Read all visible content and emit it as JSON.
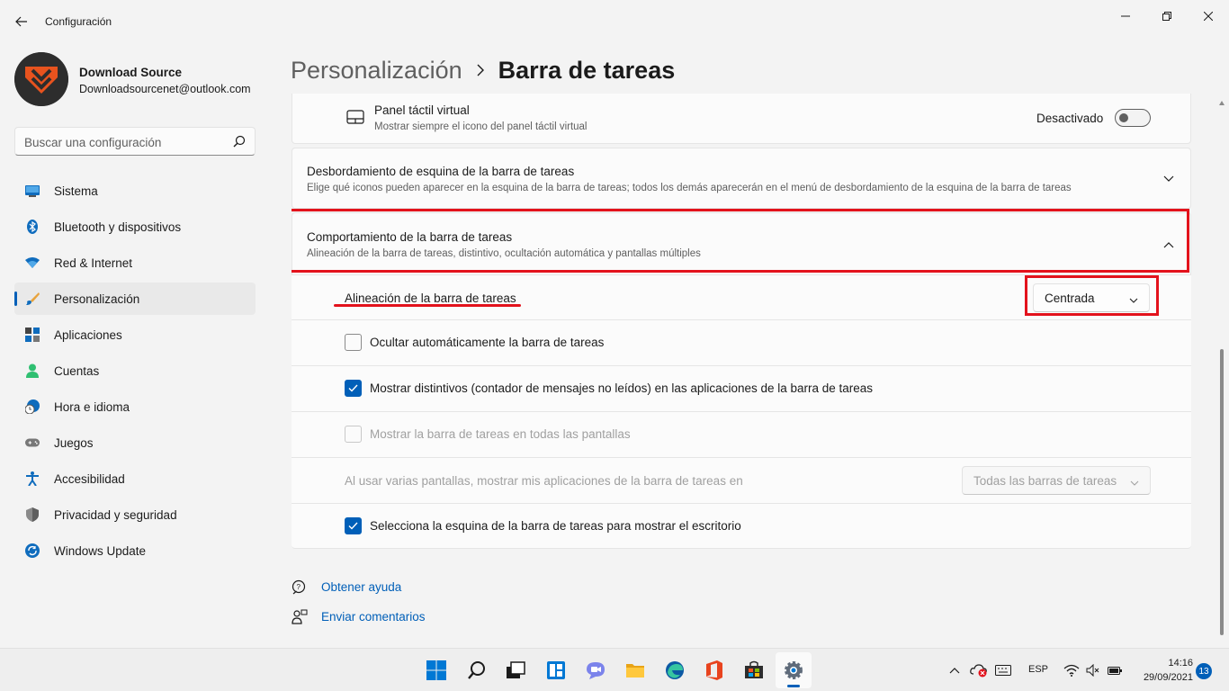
{
  "window": {
    "title": "Configuración"
  },
  "profile": {
    "name": "Download Source",
    "email": "Downloadsourcenet@outlook.com"
  },
  "search": {
    "placeholder": "Buscar una configuración"
  },
  "sidebar": {
    "items": [
      {
        "label": "Sistema",
        "icon": "system-icon"
      },
      {
        "label": "Bluetooth y dispositivos",
        "icon": "bluetooth-icon"
      },
      {
        "label": "Red & Internet",
        "icon": "wifi-icon"
      },
      {
        "label": "Personalización",
        "icon": "brush-icon",
        "active": true
      },
      {
        "label": "Aplicaciones",
        "icon": "apps-icon"
      },
      {
        "label": "Cuentas",
        "icon": "account-icon"
      },
      {
        "label": "Hora e idioma",
        "icon": "time-language-icon"
      },
      {
        "label": "Juegos",
        "icon": "gamepad-icon"
      },
      {
        "label": "Accesibilidad",
        "icon": "accessibility-icon"
      },
      {
        "label": "Privacidad y seguridad",
        "icon": "shield-icon"
      },
      {
        "label": "Windows Update",
        "icon": "update-icon"
      }
    ]
  },
  "header": {
    "parent": "Personalización",
    "current": "Barra de tareas"
  },
  "settings": {
    "touchpad": {
      "title": "Panel táctil virtual",
      "subtitle": "Mostrar siempre el icono del panel táctil virtual",
      "state_label": "Desactivado"
    },
    "overflow": {
      "title": "Desbordamiento de esquina de la barra de tareas",
      "subtitle": "Elige qué iconos pueden aparecer en la esquina de la barra de tareas; todos los demás aparecerán en el menú de desbordamiento de la esquina de la barra de tareas"
    },
    "behavior": {
      "title": "Comportamiento de la barra de tareas",
      "subtitle": "Alineación de la barra de tareas, distintivo, ocultación automática y pantallas múltiples",
      "alignment_label": "Alineación de la barra de tareas",
      "alignment_value": "Centrada",
      "autohide_label": "Ocultar automáticamente la barra de tareas",
      "badges_label": "Mostrar distintivos (contador de mensajes no leídos) en las aplicaciones de la barra de tareas",
      "all_displays_label": "Mostrar la barra de tareas en todas las pantallas",
      "multi_display_label": "Al usar varias pantallas, mostrar mis aplicaciones de la barra de tareas en",
      "multi_display_value": "Todas las barras de tareas",
      "corner_desktop_label": "Selecciona la esquina de la barra de tareas para mostrar el escritorio"
    }
  },
  "help": {
    "get_help": "Obtener ayuda",
    "feedback": "Enviar comentarios"
  },
  "taskbar": {
    "language": "ESP",
    "time": "14:16",
    "date": "29/09/2021",
    "notifications": "13"
  },
  "colors": {
    "accent": "#005fb8",
    "highlight": "#e3121c"
  }
}
